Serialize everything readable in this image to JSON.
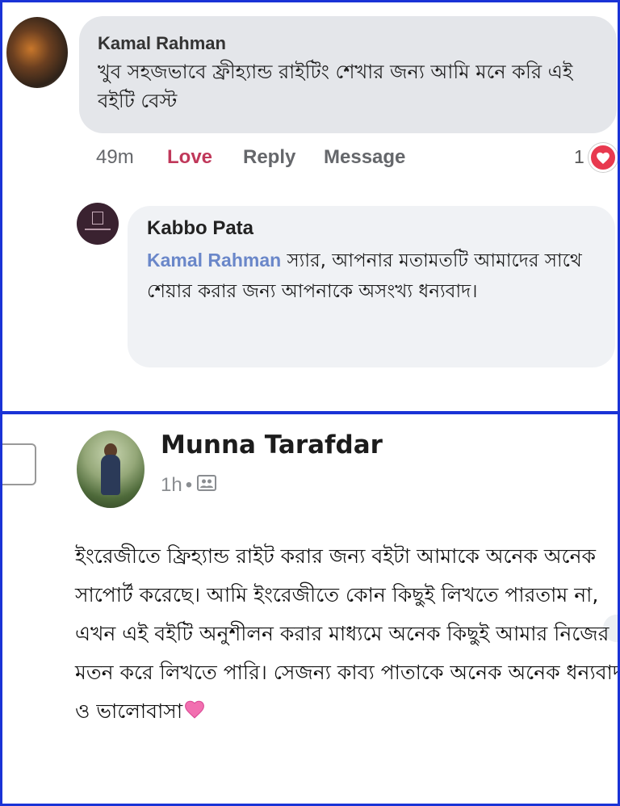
{
  "comment1": {
    "author": "Kamal Rahman",
    "text": "খুব সহজভাবে ফ্রীহ্যান্ড রাইটিং শেখার জন্য আমি মনে করি এই বইটি বেস্ট",
    "time": "49m",
    "actions": [
      "Love",
      "Reply",
      "Message"
    ],
    "reaction_count": "1",
    "reaction_icon": "heart-icon"
  },
  "reply1": {
    "author": "Kabbo Pata",
    "mention": "Kamal Rahman",
    "text": " স্যার, আপনার মতামতটি আমাদের সাথে শেয়ার করার জন্য আপনাকে অসংখ্য ধন্যবাদ।"
  },
  "comment2": {
    "author": "Munna Tarafdar",
    "time": "1h",
    "separator": "•",
    "privacy_icon": "friends-icon",
    "text": "ইংরেজীতে ফ্রিহ্যান্ড রাইট করার জন্য বইটা আমাকে অনেক অনেক সাপোর্ট করেছে। আমি ইংরেজীতে কোন কিছুই লিখতে পারতাম না, এখন এই বইটি অনুশীলন করার মাধ্যমে অনেক কিছুই আমার নিজের মতন করে লিখতে পারি। সেজন্য কাব্য পাতাকে অনেক অনেক ধন্যবাদ ও ভালোবাসা",
    "emoji": "pink-heart-icon"
  },
  "colors": {
    "frame": "#1a33d6",
    "love": "#c0385a",
    "mention": "#6a87c9",
    "reaction": "#e8394f"
  }
}
